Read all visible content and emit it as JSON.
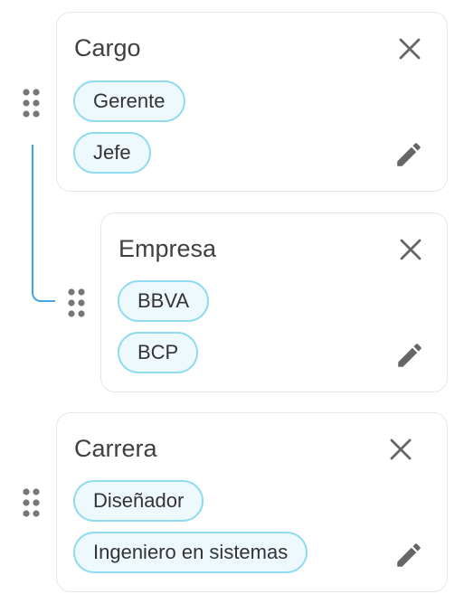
{
  "groups": [
    {
      "title": "Cargo",
      "tags": [
        "Gerente",
        "Jefe"
      ],
      "close_icon": "close-icon",
      "edit_icon": "pencil-icon",
      "drag_icon": "drag-handle-icon"
    },
    {
      "title": "Empresa",
      "tags": [
        "BBVA",
        "BCP"
      ],
      "close_icon": "close-icon",
      "edit_icon": "pencil-icon",
      "drag_icon": "drag-handle-icon",
      "nested_under": "Cargo"
    },
    {
      "title": "Carrera",
      "tags": [
        "Diseñador",
        "Ingeniero en sistemas"
      ],
      "close_icon": "close-icon",
      "edit_icon": "pencil-icon",
      "drag_icon": "drag-handle-icon"
    }
  ],
  "colors": {
    "chip_border": "#8fdbf0",
    "chip_background": "#eef9fd",
    "connector": "#42a5e8",
    "icon": "#666666",
    "card_border": "#e6e6e6"
  }
}
